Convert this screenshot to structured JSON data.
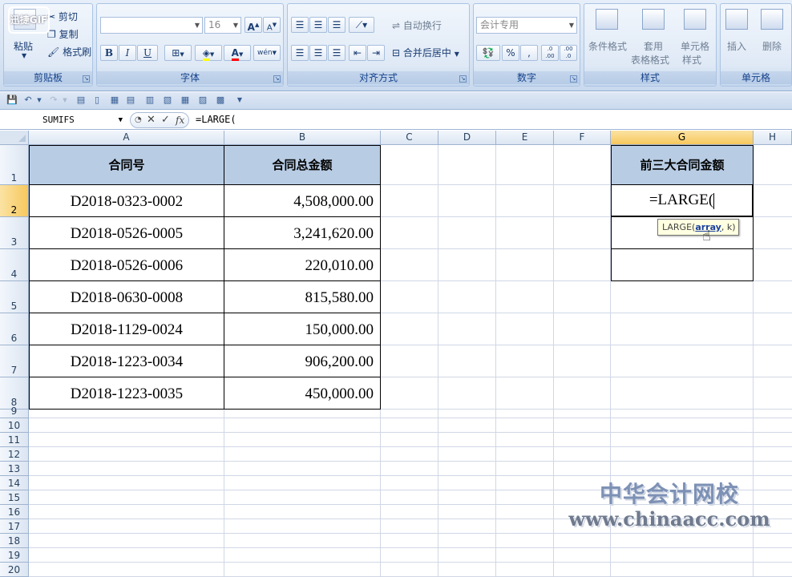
{
  "ribbon": {
    "clipboard": {
      "paste": "粘贴",
      "cut": "剪切",
      "copy": "复制",
      "format_painter": "格式刷",
      "label": "剪贴板"
    },
    "font": {
      "name": "",
      "size": "16",
      "bold": "B",
      "italic": "I",
      "underline": "U",
      "label": "字体",
      "phonetic": "wén"
    },
    "align": {
      "wrap": "自动换行",
      "merge": "合并后居中",
      "label": "对齐方式"
    },
    "number": {
      "format": "会计专用",
      "percent": "%",
      "comma": ",",
      "inc_dec": ".0 .00",
      "dec_dec": ".00 .0",
      "label": "数字"
    },
    "styles": {
      "conditional": "条件格式",
      "as_table_1": "套用",
      "as_table_2": "表格格式",
      "cell_style_1": "单元格",
      "cell_style_2": "样式",
      "label": "样式"
    },
    "cells": {
      "insert": "插入",
      "delete": "删除",
      "label": "单元格"
    }
  },
  "formula_bar": {
    "name_box": "SUMIFS",
    "fx": "fx",
    "formula": "=LARGE("
  },
  "columns": [
    "A",
    "B",
    "C",
    "D",
    "E",
    "F",
    "G",
    "H"
  ],
  "rows": [
    "1",
    "2",
    "3",
    "4",
    "5",
    "6",
    "7",
    "8",
    "9",
    "10",
    "11",
    "12",
    "13",
    "14",
    "15",
    "16",
    "17",
    "18",
    "19",
    "20"
  ],
  "table": {
    "header_contract": "合同号",
    "header_amount": "合同总金额",
    "rows": [
      {
        "contract": "D2018-0323-0002",
        "amount": "4,508,000.00"
      },
      {
        "contract": "D2018-0526-0005",
        "amount": "3,241,620.00"
      },
      {
        "contract": "D2018-0526-0006",
        "amount": "220,010.00"
      },
      {
        "contract": "D2018-0630-0008",
        "amount": "815,580.00"
      },
      {
        "contract": "D2018-1129-0024",
        "amount": "150,000.00"
      },
      {
        "contract": "D2018-1223-0034",
        "amount": "906,200.00"
      },
      {
        "contract": "D2018-1223-0035",
        "amount": "450,000.00"
      }
    ]
  },
  "top3": {
    "header": "前三大合同金额",
    "editing": "=LARGE("
  },
  "tooltip": {
    "prefix": "LARGE(",
    "arg1": "array",
    "suffix": ", k)"
  },
  "watermark": {
    "cn": "中华会计网校",
    "en": "www.chinaacc.com"
  },
  "gif_logo": "迅捷GIF",
  "colors": {
    "header_fill": "#b8cce4",
    "selected_header": "#f7c85d",
    "ribbon_text": "#15428b"
  }
}
